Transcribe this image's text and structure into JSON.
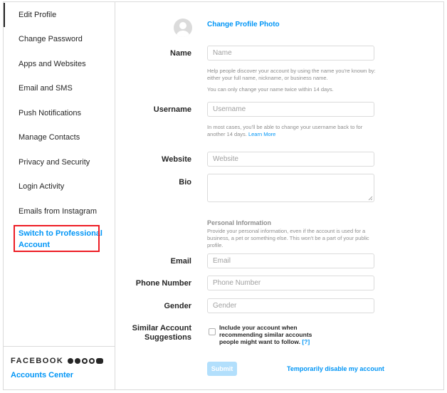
{
  "sidebar": {
    "items": [
      {
        "label": "Edit Profile"
      },
      {
        "label": "Change Password"
      },
      {
        "label": "Apps and Websites"
      },
      {
        "label": "Email and SMS"
      },
      {
        "label": "Push Notifications"
      },
      {
        "label": "Manage Contacts"
      },
      {
        "label": "Privacy and Security"
      },
      {
        "label": "Login Activity"
      },
      {
        "label": "Emails from Instagram"
      }
    ],
    "pro_line1": "Switch to Professional",
    "pro_line2": "Account",
    "highlight_color": "#ed1c24",
    "footer": {
      "brand": "FACEBOOK",
      "accounts_center": "Accounts Center"
    }
  },
  "profile": {
    "change_photo": "Change Profile Photo"
  },
  "form": {
    "name": {
      "label": "Name",
      "placeholder": "Name",
      "help1": "Help people discover your account by using the name you're known by: either your full name, nickname, or business name.",
      "help2": "You can only change your name twice within 14 days."
    },
    "username": {
      "label": "Username",
      "placeholder": "Username",
      "help": "In most cases, you'll be able to change your username back to for another 14 days.",
      "help_link": "Learn More"
    },
    "website": {
      "label": "Website",
      "placeholder": "Website"
    },
    "bio": {
      "label": "Bio"
    },
    "personal": {
      "title": "Personal Information",
      "help": "Provide your personal information, even if the account is used for a business, a pet or something else. This won't be a part of your public profile."
    },
    "email": {
      "label": "Email",
      "placeholder": "Email"
    },
    "phone": {
      "label": "Phone Number",
      "placeholder": "Phone Number"
    },
    "gender": {
      "label": "Gender",
      "placeholder": "Gender"
    },
    "similar": {
      "label_line1": "Similar Account",
      "label_line2": "Suggestions",
      "text": "Include your account when recommending similar accounts people might want to follow.",
      "help_link": "[?]"
    },
    "submit": "Submit",
    "disable": "Temporarily disable my account"
  },
  "colors": {
    "link": "#0095f6",
    "submit_disabled": "#b2dffc",
    "border": "#dbdbdb"
  }
}
